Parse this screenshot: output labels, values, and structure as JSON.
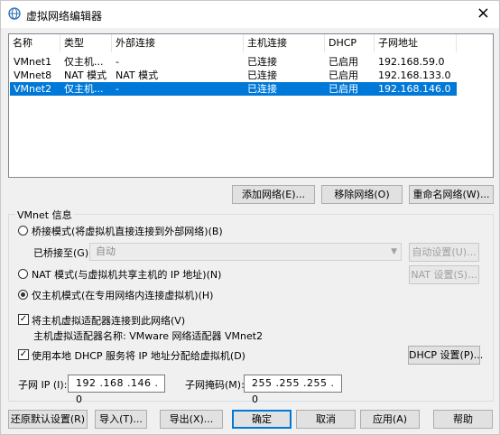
{
  "window": {
    "title": "虚拟网络编辑器",
    "close_glyph": "×"
  },
  "table": {
    "headers": [
      "名称",
      "类型",
      "外部连接",
      "主机连接",
      "DHCP",
      "子网地址"
    ],
    "rows": [
      [
        "VMnet1",
        "仅主机...",
        "-",
        "已连接",
        "已启用",
        "192.168.59.0"
      ],
      [
        "VMnet8",
        "NAT 模式",
        "NAT 模式",
        "已连接",
        "已启用",
        "192.168.133.0"
      ],
      [
        "VMnet2",
        "仅主机...",
        "-",
        "已连接",
        "已启用",
        "192.168.146.0"
      ]
    ],
    "selected_row": 2
  },
  "buttons": {
    "add_network": "添加网络(E)...",
    "remove_network": "移除网络(O)",
    "rename_network": "重命名网络(W)...",
    "auto_settings": "自动设置(U)...",
    "nat_settings": "NAT 设置(S)...",
    "dhcp_settings": "DHCP 设置(P)...",
    "restore_defaults": "还原默认设置(R)",
    "import": "导入(T)...",
    "export": "导出(X)...",
    "ok": "确定",
    "cancel": "取消",
    "apply": "应用(A)",
    "help": "帮助"
  },
  "vmnet_info": {
    "group_label": "VMnet 信息",
    "bridged_label": "桥接模式(将虚拟机直接连接到外部网络)(B)",
    "bridged_to_label": "已桥接至(G):",
    "bridged_to_value": "自动",
    "nat_label": "NAT 模式(与虚拟机共享主机的 IP 地址)(N)",
    "hostonly_label": "仅主机模式(在专用网络内连接虚拟机)(H)",
    "selected_mode": "hostonly",
    "connect_adapter_label": "将主机虚拟适配器连接到此网络(V)",
    "connect_adapter_checked": true,
    "adapter_name_label": "主机虚拟适配器名称: VMware 网络适配器 VMnet2",
    "use_dhcp_label": "使用本地 DHCP 服务将 IP 地址分配给虚拟机(D)",
    "use_dhcp_checked": true,
    "subnet_ip_label": "子网 IP (I):",
    "subnet_ip_value": "192 .168 .146 . 0",
    "subnet_mask_label": "子网掩码(M):",
    "subnet_mask_value": "255 .255 .255 . 0"
  },
  "colors": {
    "selection": "#0078d7",
    "window_bg": "#f0f0f0"
  }
}
